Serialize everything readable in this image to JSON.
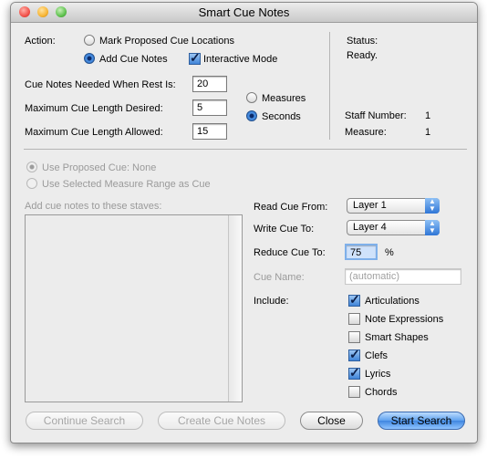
{
  "window": {
    "title": "Smart Cue Notes"
  },
  "action": {
    "label": "Action:",
    "mark_proposed": "Mark Proposed Cue Locations",
    "add_cue_notes": "Add Cue Notes",
    "interactive_mode": "Interactive Mode",
    "interactive_checked": true
  },
  "fields": {
    "rest_label": "Cue Notes Needed When Rest Is:",
    "rest_value": "20",
    "desired_label": "Maximum Cue Length Desired:",
    "desired_value": "5",
    "allowed_label": "Maximum Cue Length Allowed:",
    "allowed_value": "15"
  },
  "units": {
    "measures": "Measures",
    "seconds": "Seconds",
    "selected": "Seconds"
  },
  "status": {
    "label": "Status:",
    "value": "Ready.",
    "staff_label": "Staff Number:",
    "staff_value": "1",
    "measure_label": "Measure:",
    "measure_value": "1"
  },
  "proposed": {
    "use_proposed": "Use Proposed Cue:  None",
    "use_selected_range": "Use Selected Measure Range as Cue",
    "staves_label": "Add cue notes to these staves:"
  },
  "options": {
    "read_label": "Read Cue From:",
    "read_value": "Layer 1",
    "write_label": "Write Cue To:",
    "write_value": "Layer 4",
    "reduce_label": "Reduce Cue To:",
    "reduce_value": "75",
    "reduce_unit": "%",
    "cue_name_label": "Cue Name:",
    "cue_name_placeholder": "(automatic)",
    "include_label": "Include:"
  },
  "include": [
    {
      "label": "Articulations",
      "checked": true
    },
    {
      "label": "Note Expressions",
      "checked": false
    },
    {
      "label": "Smart Shapes",
      "checked": false
    },
    {
      "label": "Clefs",
      "checked": true
    },
    {
      "label": "Lyrics",
      "checked": true
    },
    {
      "label": "Chords",
      "checked": false
    }
  ],
  "buttons": {
    "continue_search": "Continue Search",
    "create_cue_notes": "Create Cue Notes",
    "close": "Close",
    "start_search": "Start Search"
  },
  "colors": {
    "close_light": "#f2524a",
    "minimize_light": "#f7b534",
    "zoom_light": "#5fc24f",
    "default_button": "#3f86e0"
  }
}
